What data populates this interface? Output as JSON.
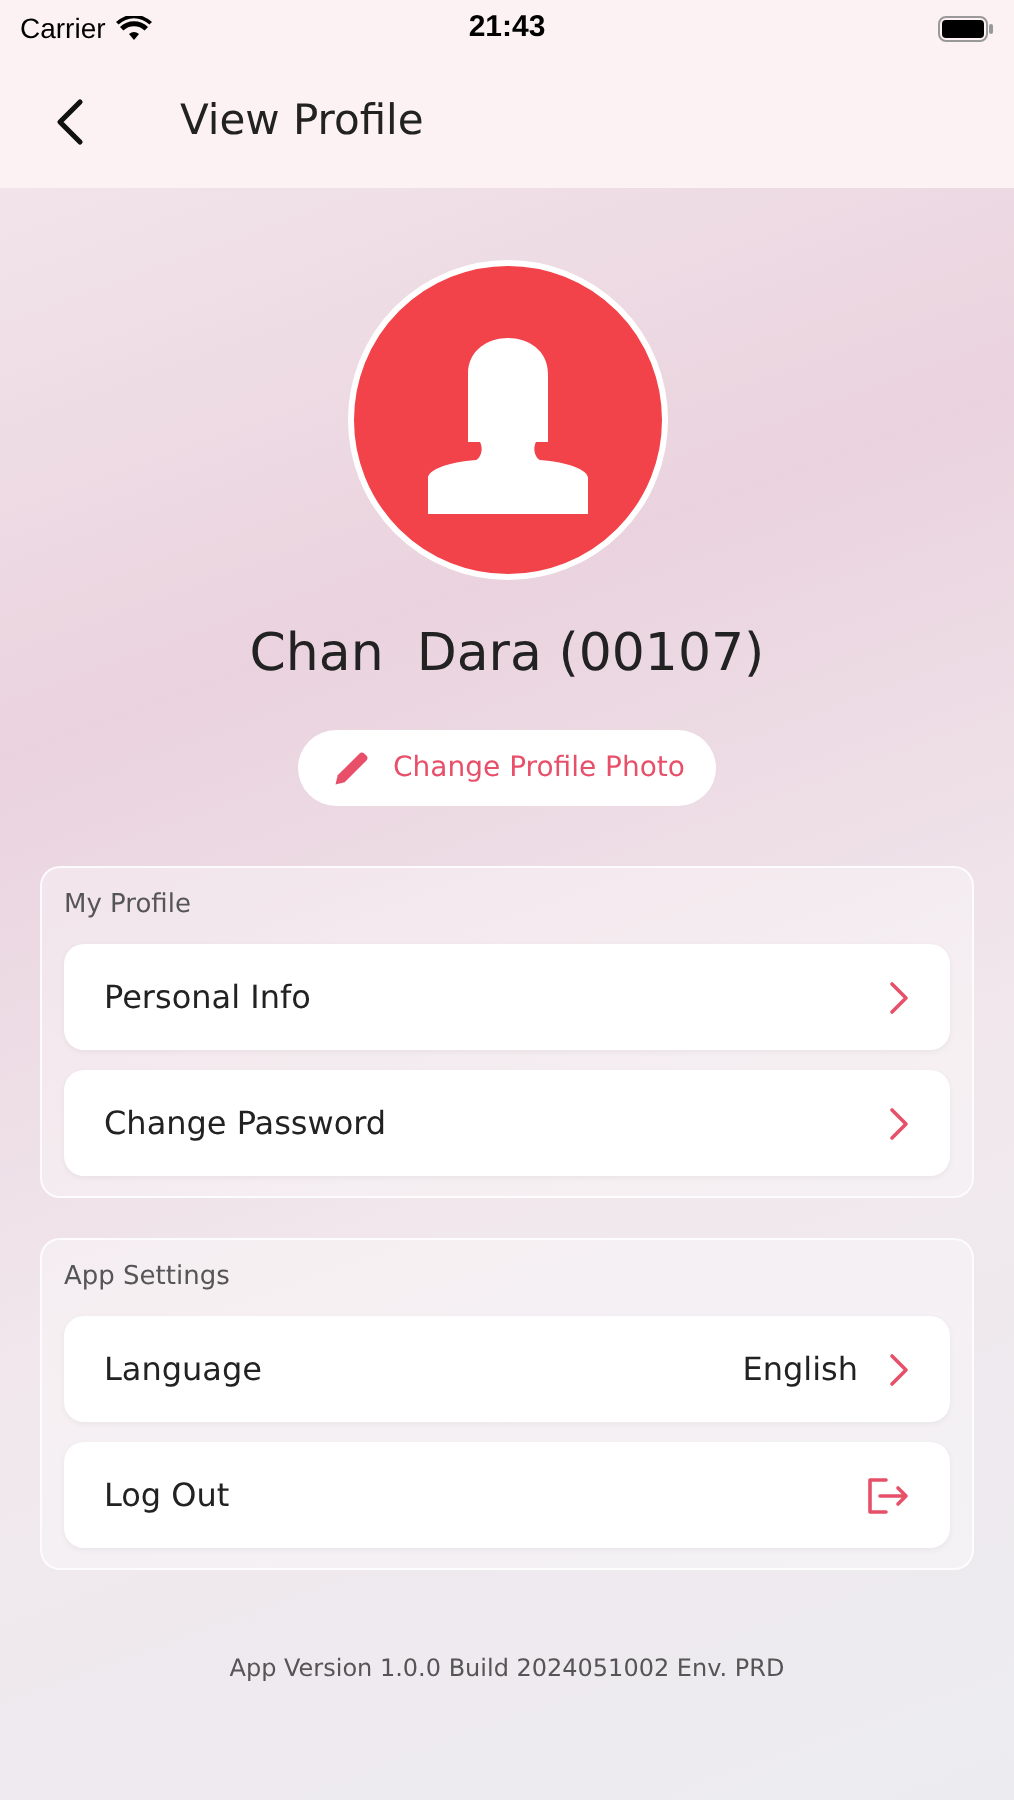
{
  "status_bar": {
    "carrier": "Carrier",
    "time": "21:43"
  },
  "header": {
    "title": "View Profile"
  },
  "profile": {
    "name": "Chan  Dara (00107)",
    "change_photo": "Change Profile Photo"
  },
  "sections": [
    {
      "title": "My Profile",
      "items": [
        {
          "kind": "chevron",
          "label": "Personal Info"
        },
        {
          "kind": "chevron",
          "label": "Change Password"
        }
      ]
    },
    {
      "title": "App Settings",
      "items": [
        {
          "kind": "chevron",
          "label": "Language",
          "value": "English"
        },
        {
          "kind": "logout",
          "label": "Log Out"
        }
      ]
    }
  ],
  "footer": "App Version 1.0.0 Build 2024051002 Env. PRD"
}
